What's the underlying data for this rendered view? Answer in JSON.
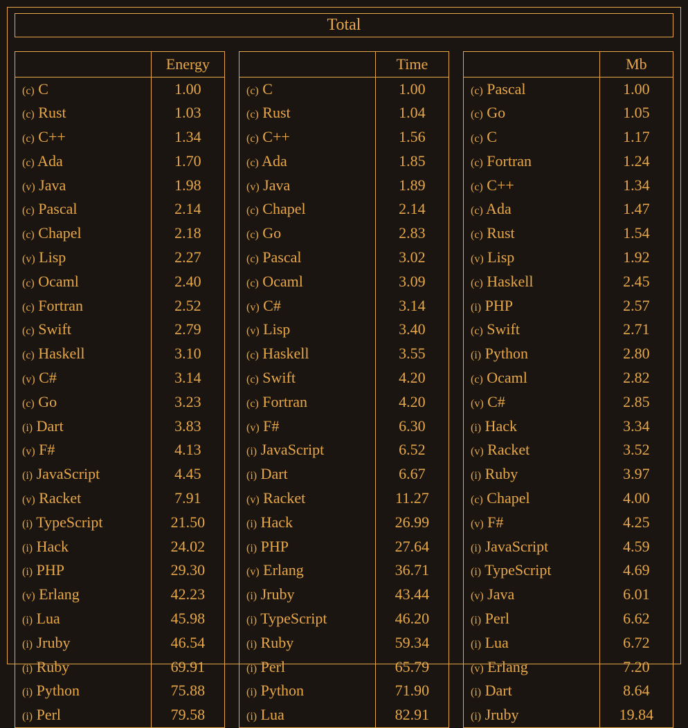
{
  "title": "Total",
  "columns": [
    {
      "metric": "Energy",
      "rows": [
        {
          "prefix": "(c)",
          "name": "C",
          "value": "1.00"
        },
        {
          "prefix": "(c)",
          "name": "Rust",
          "value": "1.03"
        },
        {
          "prefix": "(c)",
          "name": "C++",
          "value": "1.34"
        },
        {
          "prefix": "(c)",
          "name": "Ada",
          "value": "1.70"
        },
        {
          "prefix": "(v)",
          "name": "Java",
          "value": "1.98"
        },
        {
          "prefix": "(c)",
          "name": "Pascal",
          "value": "2.14"
        },
        {
          "prefix": "(c)",
          "name": "Chapel",
          "value": "2.18"
        },
        {
          "prefix": "(v)",
          "name": "Lisp",
          "value": "2.27"
        },
        {
          "prefix": "(c)",
          "name": "Ocaml",
          "value": "2.40"
        },
        {
          "prefix": "(c)",
          "name": "Fortran",
          "value": "2.52"
        },
        {
          "prefix": "(c)",
          "name": "Swift",
          "value": "2.79"
        },
        {
          "prefix": "(c)",
          "name": "Haskell",
          "value": "3.10"
        },
        {
          "prefix": "(v)",
          "name": "C#",
          "value": "3.14"
        },
        {
          "prefix": "(c)",
          "name": "Go",
          "value": "3.23"
        },
        {
          "prefix": "(i)",
          "name": "Dart",
          "value": "3.83"
        },
        {
          "prefix": "(v)",
          "name": "F#",
          "value": "4.13"
        },
        {
          "prefix": "(i)",
          "name": "JavaScript",
          "value": "4.45"
        },
        {
          "prefix": "(v)",
          "name": "Racket",
          "value": "7.91"
        },
        {
          "prefix": "(i)",
          "name": "TypeScript",
          "value": "21.50"
        },
        {
          "prefix": "(i)",
          "name": "Hack",
          "value": "24.02"
        },
        {
          "prefix": "(i)",
          "name": "PHP",
          "value": "29.30"
        },
        {
          "prefix": "(v)",
          "name": "Erlang",
          "value": "42.23"
        },
        {
          "prefix": "(i)",
          "name": "Lua",
          "value": "45.98"
        },
        {
          "prefix": "(i)",
          "name": "Jruby",
          "value": "46.54"
        },
        {
          "prefix": "(i)",
          "name": "Ruby",
          "value": "69.91"
        },
        {
          "prefix": "(i)",
          "name": "Python",
          "value": "75.88"
        },
        {
          "prefix": "(i)",
          "name": "Perl",
          "value": "79.58"
        }
      ]
    },
    {
      "metric": "Time",
      "rows": [
        {
          "prefix": "(c)",
          "name": "C",
          "value": "1.00"
        },
        {
          "prefix": "(c)",
          "name": "Rust",
          "value": "1.04"
        },
        {
          "prefix": "(c)",
          "name": "C++",
          "value": "1.56"
        },
        {
          "prefix": "(c)",
          "name": "Ada",
          "value": "1.85"
        },
        {
          "prefix": "(v)",
          "name": "Java",
          "value": "1.89"
        },
        {
          "prefix": "(c)",
          "name": "Chapel",
          "value": "2.14"
        },
        {
          "prefix": "(c)",
          "name": "Go",
          "value": "2.83"
        },
        {
          "prefix": "(c)",
          "name": "Pascal",
          "value": "3.02"
        },
        {
          "prefix": "(c)",
          "name": "Ocaml",
          "value": "3.09"
        },
        {
          "prefix": "(v)",
          "name": "C#",
          "value": "3.14"
        },
        {
          "prefix": "(v)",
          "name": "Lisp",
          "value": "3.40"
        },
        {
          "prefix": "(c)",
          "name": "Haskell",
          "value": "3.55"
        },
        {
          "prefix": "(c)",
          "name": "Swift",
          "value": "4.20"
        },
        {
          "prefix": "(c)",
          "name": "Fortran",
          "value": "4.20"
        },
        {
          "prefix": "(v)",
          "name": "F#",
          "value": "6.30"
        },
        {
          "prefix": "(i)",
          "name": "JavaScript",
          "value": "6.52"
        },
        {
          "prefix": "(i)",
          "name": "Dart",
          "value": "6.67"
        },
        {
          "prefix": "(v)",
          "name": "Racket",
          "value": "11.27"
        },
        {
          "prefix": "(i)",
          "name": "Hack",
          "value": "26.99"
        },
        {
          "prefix": "(i)",
          "name": "PHP",
          "value": "27.64"
        },
        {
          "prefix": "(v)",
          "name": "Erlang",
          "value": "36.71"
        },
        {
          "prefix": "(i)",
          "name": "Jruby",
          "value": "43.44"
        },
        {
          "prefix": "(i)",
          "name": "TypeScript",
          "value": "46.20"
        },
        {
          "prefix": "(i)",
          "name": "Ruby",
          "value": "59.34"
        },
        {
          "prefix": "(i)",
          "name": "Perl",
          "value": "65.79"
        },
        {
          "prefix": "(i)",
          "name": "Python",
          "value": "71.90"
        },
        {
          "prefix": "(i)",
          "name": "Lua",
          "value": "82.91"
        }
      ]
    },
    {
      "metric": "Mb",
      "rows": [
        {
          "prefix": "(c)",
          "name": "Pascal",
          "value": "1.00"
        },
        {
          "prefix": "(c)",
          "name": "Go",
          "value": "1.05"
        },
        {
          "prefix": "(c)",
          "name": "C",
          "value": "1.17"
        },
        {
          "prefix": "(c)",
          "name": "Fortran",
          "value": "1.24"
        },
        {
          "prefix": "(c)",
          "name": "C++",
          "value": "1.34"
        },
        {
          "prefix": "(c)",
          "name": "Ada",
          "value": "1.47"
        },
        {
          "prefix": "(c)",
          "name": "Rust",
          "value": "1.54"
        },
        {
          "prefix": "(v)",
          "name": "Lisp",
          "value": "1.92"
        },
        {
          "prefix": "(c)",
          "name": "Haskell",
          "value": "2.45"
        },
        {
          "prefix": "(i)",
          "name": "PHP",
          "value": "2.57"
        },
        {
          "prefix": "(c)",
          "name": "Swift",
          "value": "2.71"
        },
        {
          "prefix": "(i)",
          "name": "Python",
          "value": "2.80"
        },
        {
          "prefix": "(c)",
          "name": "Ocaml",
          "value": "2.82"
        },
        {
          "prefix": "(v)",
          "name": "C#",
          "value": "2.85"
        },
        {
          "prefix": "(i)",
          "name": "Hack",
          "value": "3.34"
        },
        {
          "prefix": "(v)",
          "name": "Racket",
          "value": "3.52"
        },
        {
          "prefix": "(i)",
          "name": "Ruby",
          "value": "3.97"
        },
        {
          "prefix": "(c)",
          "name": "Chapel",
          "value": "4.00"
        },
        {
          "prefix": "(v)",
          "name": "F#",
          "value": "4.25"
        },
        {
          "prefix": "(i)",
          "name": "JavaScript",
          "value": "4.59"
        },
        {
          "prefix": "(i)",
          "name": "TypeScript",
          "value": "4.69"
        },
        {
          "prefix": "(v)",
          "name": "Java",
          "value": "6.01"
        },
        {
          "prefix": "(i)",
          "name": "Perl",
          "value": "6.62"
        },
        {
          "prefix": "(i)",
          "name": "Lua",
          "value": "6.72"
        },
        {
          "prefix": "(v)",
          "name": "Erlang",
          "value": "7.20"
        },
        {
          "prefix": "(i)",
          "name": "Dart",
          "value": "8.64"
        },
        {
          "prefix": "(i)",
          "name": "Jruby",
          "value": "19.84"
        }
      ]
    }
  ],
  "chart_data": {
    "type": "table",
    "title": "Total",
    "series": [
      {
        "name": "Energy",
        "categories": [
          "C",
          "Rust",
          "C++",
          "Ada",
          "Java",
          "Pascal",
          "Chapel",
          "Lisp",
          "Ocaml",
          "Fortran",
          "Swift",
          "Haskell",
          "C#",
          "Go",
          "Dart",
          "F#",
          "JavaScript",
          "Racket",
          "TypeScript",
          "Hack",
          "PHP",
          "Erlang",
          "Lua",
          "Jruby",
          "Ruby",
          "Python",
          "Perl"
        ],
        "values": [
          1.0,
          1.03,
          1.34,
          1.7,
          1.98,
          2.14,
          2.18,
          2.27,
          2.4,
          2.52,
          2.79,
          3.1,
          3.14,
          3.23,
          3.83,
          4.13,
          4.45,
          7.91,
          21.5,
          24.02,
          29.3,
          42.23,
          45.98,
          46.54,
          69.91,
          75.88,
          79.58
        ]
      },
      {
        "name": "Time",
        "categories": [
          "C",
          "Rust",
          "C++",
          "Ada",
          "Java",
          "Chapel",
          "Go",
          "Pascal",
          "Ocaml",
          "C#",
          "Lisp",
          "Haskell",
          "Swift",
          "Fortran",
          "F#",
          "JavaScript",
          "Dart",
          "Racket",
          "Hack",
          "PHP",
          "Erlang",
          "Jruby",
          "TypeScript",
          "Ruby",
          "Perl",
          "Python",
          "Lua"
        ],
        "values": [
          1.0,
          1.04,
          1.56,
          1.85,
          1.89,
          2.14,
          2.83,
          3.02,
          3.09,
          3.14,
          3.4,
          3.55,
          4.2,
          4.2,
          6.3,
          6.52,
          6.67,
          11.27,
          26.99,
          27.64,
          36.71,
          43.44,
          46.2,
          59.34,
          65.79,
          71.9,
          82.91
        ]
      },
      {
        "name": "Mb",
        "categories": [
          "Pascal",
          "Go",
          "C",
          "Fortran",
          "C++",
          "Ada",
          "Rust",
          "Lisp",
          "Haskell",
          "PHP",
          "Swift",
          "Python",
          "Ocaml",
          "C#",
          "Hack",
          "Racket",
          "Ruby",
          "Chapel",
          "F#",
          "JavaScript",
          "TypeScript",
          "Java",
          "Perl",
          "Lua",
          "Erlang",
          "Dart",
          "Jruby"
        ],
        "values": [
          1.0,
          1.05,
          1.17,
          1.24,
          1.34,
          1.47,
          1.54,
          1.92,
          2.45,
          2.57,
          2.71,
          2.8,
          2.82,
          2.85,
          3.34,
          3.52,
          3.97,
          4.0,
          4.25,
          4.59,
          4.69,
          6.01,
          6.62,
          6.72,
          7.2,
          8.64,
          19.84
        ]
      }
    ]
  }
}
